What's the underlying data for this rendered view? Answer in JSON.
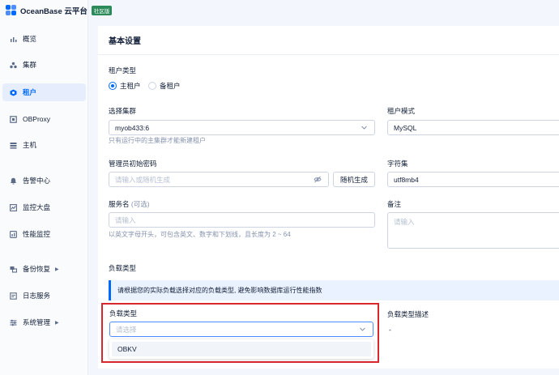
{
  "app": {
    "brand": "OceanBase 云平台",
    "edition_badge": "社区版"
  },
  "sidebar": {
    "items": [
      {
        "label": "概览",
        "icon": "bar-chart-icon"
      },
      {
        "label": "集群",
        "icon": "cluster-icon"
      },
      {
        "label": "租户",
        "icon": "tenant-icon",
        "active": true
      },
      {
        "label": "OBProxy",
        "icon": "proxy-icon"
      },
      {
        "label": "主机",
        "icon": "host-icon"
      },
      {
        "label": "告警中心",
        "icon": "alert-icon"
      },
      {
        "label": "监控大盘",
        "icon": "dashboard-icon"
      },
      {
        "label": "性能监控",
        "icon": "performance-icon"
      },
      {
        "label": "备份恢复",
        "icon": "backup-icon",
        "expandable": true
      },
      {
        "label": "日志服务",
        "icon": "log-icon"
      },
      {
        "label": "系统管理",
        "icon": "settings-icon",
        "expandable": true
      }
    ]
  },
  "form": {
    "section_title": "基本设置",
    "tenant_type": {
      "label": "租户类型",
      "options": [
        "主租户",
        "备租户"
      ],
      "selected": "主租户"
    },
    "cluster": {
      "label": "选择集群",
      "value": "myob433:6",
      "help": "只有运行中的主集群才能新建租户"
    },
    "tenant_mode": {
      "label": "租户模式",
      "value": "MySQL"
    },
    "admin_password": {
      "label": "管理员初始密码",
      "placeholder": "请输入或随机生成",
      "random_button": "随机生成"
    },
    "charset": {
      "label": "字符集",
      "value": "utf8mb4"
    },
    "service_name": {
      "label": "服务名",
      "optional": "(可选)",
      "placeholder": "请输入",
      "help": "以英文字母开头，可包含英文、数字和下划线，且长度为 2 ~ 64"
    },
    "remark": {
      "label": "备注",
      "placeholder": "请输入"
    },
    "workload_section_label": "负载类型",
    "workload_alert": "请根据您的实际负载选择对应的负载类型, 避免影响数据库运行性能指数",
    "workload_type": {
      "label": "负载类型",
      "placeholder": "请选择",
      "dropdown_options": [
        "OBKV"
      ]
    },
    "workload_desc": {
      "label": "负载类型描述",
      "value": "-"
    }
  },
  "colors": {
    "accent": "#006aff",
    "highlight_box": "#d9272e",
    "badge": "#2b8a5a"
  }
}
